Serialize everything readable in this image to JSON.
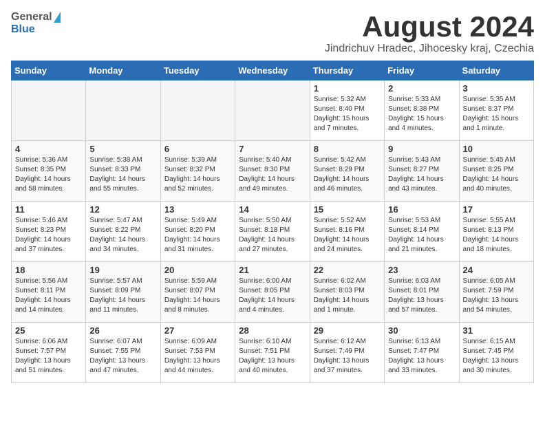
{
  "header": {
    "logo_general": "General",
    "logo_blue": "Blue",
    "title": "August 2024",
    "location": "Jindrichuv Hradec, Jihocesky kraj, Czechia"
  },
  "days_of_week": [
    "Sunday",
    "Monday",
    "Tuesday",
    "Wednesday",
    "Thursday",
    "Friday",
    "Saturday"
  ],
  "weeks": [
    [
      {
        "day": "",
        "sunrise": "",
        "sunset": "",
        "daylight": "",
        "empty": true
      },
      {
        "day": "",
        "sunrise": "",
        "sunset": "",
        "daylight": "",
        "empty": true
      },
      {
        "day": "",
        "sunrise": "",
        "sunset": "",
        "daylight": "",
        "empty": true
      },
      {
        "day": "",
        "sunrise": "",
        "sunset": "",
        "daylight": "",
        "empty": true
      },
      {
        "day": "1",
        "sunrise": "Sunrise: 5:32 AM",
        "sunset": "Sunset: 8:40 PM",
        "daylight": "Daylight: 15 hours and 7 minutes.",
        "empty": false
      },
      {
        "day": "2",
        "sunrise": "Sunrise: 5:33 AM",
        "sunset": "Sunset: 8:38 PM",
        "daylight": "Daylight: 15 hours and 4 minutes.",
        "empty": false
      },
      {
        "day": "3",
        "sunrise": "Sunrise: 5:35 AM",
        "sunset": "Sunset: 8:37 PM",
        "daylight": "Daylight: 15 hours and 1 minute.",
        "empty": false
      }
    ],
    [
      {
        "day": "4",
        "sunrise": "Sunrise: 5:36 AM",
        "sunset": "Sunset: 8:35 PM",
        "daylight": "Daylight: 14 hours and 58 minutes.",
        "empty": false
      },
      {
        "day": "5",
        "sunrise": "Sunrise: 5:38 AM",
        "sunset": "Sunset: 8:33 PM",
        "daylight": "Daylight: 14 hours and 55 minutes.",
        "empty": false
      },
      {
        "day": "6",
        "sunrise": "Sunrise: 5:39 AM",
        "sunset": "Sunset: 8:32 PM",
        "daylight": "Daylight: 14 hours and 52 minutes.",
        "empty": false
      },
      {
        "day": "7",
        "sunrise": "Sunrise: 5:40 AM",
        "sunset": "Sunset: 8:30 PM",
        "daylight": "Daylight: 14 hours and 49 minutes.",
        "empty": false
      },
      {
        "day": "8",
        "sunrise": "Sunrise: 5:42 AM",
        "sunset": "Sunset: 8:29 PM",
        "daylight": "Daylight: 14 hours and 46 minutes.",
        "empty": false
      },
      {
        "day": "9",
        "sunrise": "Sunrise: 5:43 AM",
        "sunset": "Sunset: 8:27 PM",
        "daylight": "Daylight: 14 hours and 43 minutes.",
        "empty": false
      },
      {
        "day": "10",
        "sunrise": "Sunrise: 5:45 AM",
        "sunset": "Sunset: 8:25 PM",
        "daylight": "Daylight: 14 hours and 40 minutes.",
        "empty": false
      }
    ],
    [
      {
        "day": "11",
        "sunrise": "Sunrise: 5:46 AM",
        "sunset": "Sunset: 8:23 PM",
        "daylight": "Daylight: 14 hours and 37 minutes.",
        "empty": false
      },
      {
        "day": "12",
        "sunrise": "Sunrise: 5:47 AM",
        "sunset": "Sunset: 8:22 PM",
        "daylight": "Daylight: 14 hours and 34 minutes.",
        "empty": false
      },
      {
        "day": "13",
        "sunrise": "Sunrise: 5:49 AM",
        "sunset": "Sunset: 8:20 PM",
        "daylight": "Daylight: 14 hours and 31 minutes.",
        "empty": false
      },
      {
        "day": "14",
        "sunrise": "Sunrise: 5:50 AM",
        "sunset": "Sunset: 8:18 PM",
        "daylight": "Daylight: 14 hours and 27 minutes.",
        "empty": false
      },
      {
        "day": "15",
        "sunrise": "Sunrise: 5:52 AM",
        "sunset": "Sunset: 8:16 PM",
        "daylight": "Daylight: 14 hours and 24 minutes.",
        "empty": false
      },
      {
        "day": "16",
        "sunrise": "Sunrise: 5:53 AM",
        "sunset": "Sunset: 8:14 PM",
        "daylight": "Daylight: 14 hours and 21 minutes.",
        "empty": false
      },
      {
        "day": "17",
        "sunrise": "Sunrise: 5:55 AM",
        "sunset": "Sunset: 8:13 PM",
        "daylight": "Daylight: 14 hours and 18 minutes.",
        "empty": false
      }
    ],
    [
      {
        "day": "18",
        "sunrise": "Sunrise: 5:56 AM",
        "sunset": "Sunset: 8:11 PM",
        "daylight": "Daylight: 14 hours and 14 minutes.",
        "empty": false
      },
      {
        "day": "19",
        "sunrise": "Sunrise: 5:57 AM",
        "sunset": "Sunset: 8:09 PM",
        "daylight": "Daylight: 14 hours and 11 minutes.",
        "empty": false
      },
      {
        "day": "20",
        "sunrise": "Sunrise: 5:59 AM",
        "sunset": "Sunset: 8:07 PM",
        "daylight": "Daylight: 14 hours and 8 minutes.",
        "empty": false
      },
      {
        "day": "21",
        "sunrise": "Sunrise: 6:00 AM",
        "sunset": "Sunset: 8:05 PM",
        "daylight": "Daylight: 14 hours and 4 minutes.",
        "empty": false
      },
      {
        "day": "22",
        "sunrise": "Sunrise: 6:02 AM",
        "sunset": "Sunset: 8:03 PM",
        "daylight": "Daylight: 14 hours and 1 minute.",
        "empty": false
      },
      {
        "day": "23",
        "sunrise": "Sunrise: 6:03 AM",
        "sunset": "Sunset: 8:01 PM",
        "daylight": "Daylight: 13 hours and 57 minutes.",
        "empty": false
      },
      {
        "day": "24",
        "sunrise": "Sunrise: 6:05 AM",
        "sunset": "Sunset: 7:59 PM",
        "daylight": "Daylight: 13 hours and 54 minutes.",
        "empty": false
      }
    ],
    [
      {
        "day": "25",
        "sunrise": "Sunrise: 6:06 AM",
        "sunset": "Sunset: 7:57 PM",
        "daylight": "Daylight: 13 hours and 51 minutes.",
        "empty": false
      },
      {
        "day": "26",
        "sunrise": "Sunrise: 6:07 AM",
        "sunset": "Sunset: 7:55 PM",
        "daylight": "Daylight: 13 hours and 47 minutes.",
        "empty": false
      },
      {
        "day": "27",
        "sunrise": "Sunrise: 6:09 AM",
        "sunset": "Sunset: 7:53 PM",
        "daylight": "Daylight: 13 hours and 44 minutes.",
        "empty": false
      },
      {
        "day": "28",
        "sunrise": "Sunrise: 6:10 AM",
        "sunset": "Sunset: 7:51 PM",
        "daylight": "Daylight: 13 hours and 40 minutes.",
        "empty": false
      },
      {
        "day": "29",
        "sunrise": "Sunrise: 6:12 AM",
        "sunset": "Sunset: 7:49 PM",
        "daylight": "Daylight: 13 hours and 37 minutes.",
        "empty": false
      },
      {
        "day": "30",
        "sunrise": "Sunrise: 6:13 AM",
        "sunset": "Sunset: 7:47 PM",
        "daylight": "Daylight: 13 hours and 33 minutes.",
        "empty": false
      },
      {
        "day": "31",
        "sunrise": "Sunrise: 6:15 AM",
        "sunset": "Sunset: 7:45 PM",
        "daylight": "Daylight: 13 hours and 30 minutes.",
        "empty": false
      }
    ]
  ]
}
